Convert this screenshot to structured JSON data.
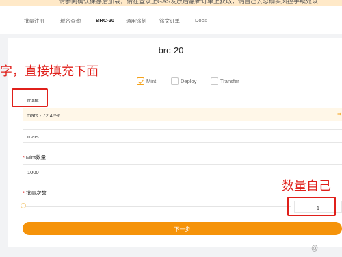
{
  "banner": {
    "text": "请参阅确认保存后加载，请在登录上GAS发放后最新订单上获取，请自己去总确实风控手续处以…"
  },
  "nav": {
    "tabs": [
      {
        "label": "批量注册"
      },
      {
        "label": "域名查询"
      },
      {
        "label": "BRC-20"
      },
      {
        "label": "通用铭刻"
      },
      {
        "label": "铭文订单"
      },
      {
        "label": "Docs"
      }
    ],
    "active_index": 2
  },
  "page": {
    "title": "brc-20"
  },
  "options": [
    {
      "label": "Mint",
      "checked": true
    },
    {
      "label": "Deploy",
      "checked": false
    },
    {
      "label": "Transfer",
      "checked": false
    }
  ],
  "search": {
    "value": "mars"
  },
  "suggestion": {
    "text": "mars - 72.46%",
    "icon": "pick-icon"
  },
  "selected_token": {
    "value": "mars"
  },
  "mint_amount": {
    "label": "Mint数量",
    "value": "1000"
  },
  "batch": {
    "label": "批量次数",
    "value": "1"
  },
  "actions": {
    "next_label": "下一步"
  },
  "annotations": {
    "left_text": "字，直接填充下面",
    "right_text": "数量自己",
    "color": "#e0201b"
  },
  "watermark": {
    "text": "@"
  },
  "colors": {
    "accent": "#f5930a",
    "required": "#e34a4a"
  }
}
